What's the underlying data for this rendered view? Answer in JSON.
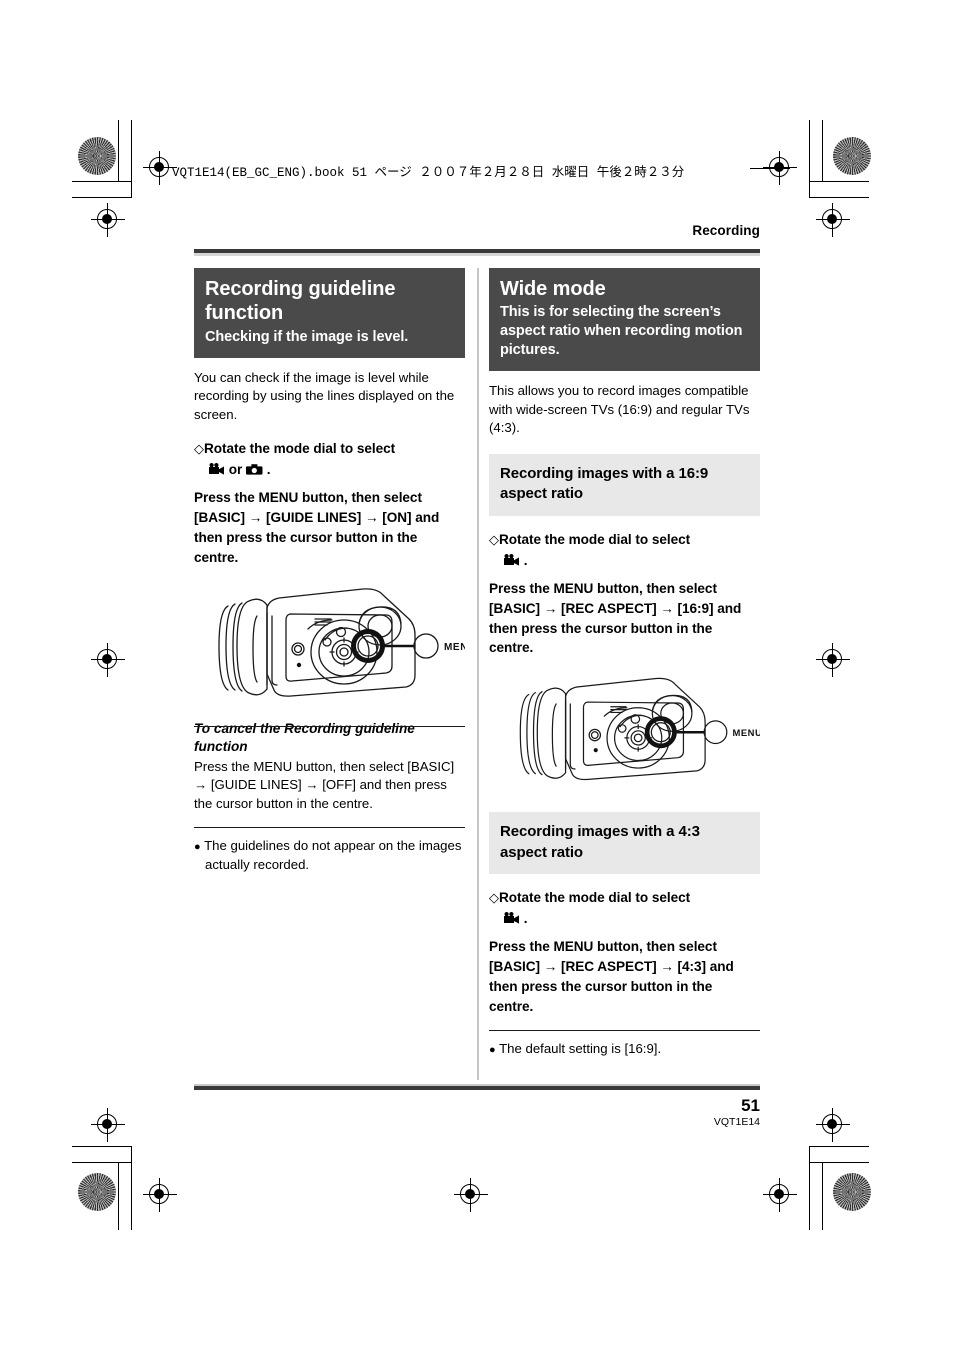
{
  "print_header": {
    "filename_line": "VQT1E14(EB_GC_ENG).book   51 ページ   ２００７年２月２８日   水曜日   午後２時２３分"
  },
  "running_head": "Recording",
  "left_column": {
    "banner": {
      "title": "Recording guideline function",
      "subtitle": "Checking if the image is level."
    },
    "intro": "You can check if the image is level while recording by using the lines displayed on the screen.",
    "step_rotate_prefix": "Rotate the mode dial to select",
    "step_rotate_icons_suffix": "or",
    "step_rotate_end": ".",
    "step_press": "Press the MENU button, then select [BASIC] → [GUIDE LINES] → [ON] and then press the cursor button in the centre.",
    "figure_callout": "MENU",
    "cancel_heading": "To cancel the Recording guideline function",
    "cancel_body": "Press the MENU button, then select [BASIC] → [GUIDE LINES] → [OFF] and then press the cursor button in the centre.",
    "note": "The guidelines do not appear on the images actually recorded.",
    "note_bullet": "●"
  },
  "right_column": {
    "banner": {
      "title": "Wide mode",
      "subtitle": "This is for selecting the screen’s aspect ratio when recording motion pictures."
    },
    "intro": "This allows you to record images compatible with wide-screen TVs (16:9) and regular TVs (4:3).",
    "section_16_9": {
      "heading": "Recording images with a 16:9 aspect ratio",
      "step_rotate": "Rotate the mode dial to select",
      "step_rotate_end": ".",
      "step_press": "Press the MENU button, then select [BASIC] → [REC ASPECT] → [16:9] and then press the cursor button in the centre.",
      "figure_callout": "MENU"
    },
    "section_4_3": {
      "heading": "Recording images with a 4:3 aspect ratio",
      "step_rotate": "Rotate the mode dial to select",
      "step_rotate_end": ".",
      "step_press": "Press the MENU button, then select [BASIC] → [REC ASPECT] → [4:3] and then press the cursor button in the centre."
    },
    "note": "The default setting is [16:9].",
    "note_bullet": "●"
  },
  "footer": {
    "page_number": "51",
    "doc_code": "VQT1E14"
  },
  "colors": {
    "banner_bg": "#4a4a4a",
    "subhead_bg": "#e8e8e8",
    "rule_dark": "#3a3a3a",
    "rule_light": "#d6d6d6",
    "divider": "#c6c6c6",
    "text": "#000000"
  },
  "icons": {
    "diamond": "◇",
    "arrow": "→",
    "video_camera": "video-camera-icon",
    "still_camera": "still-camera-icon"
  }
}
